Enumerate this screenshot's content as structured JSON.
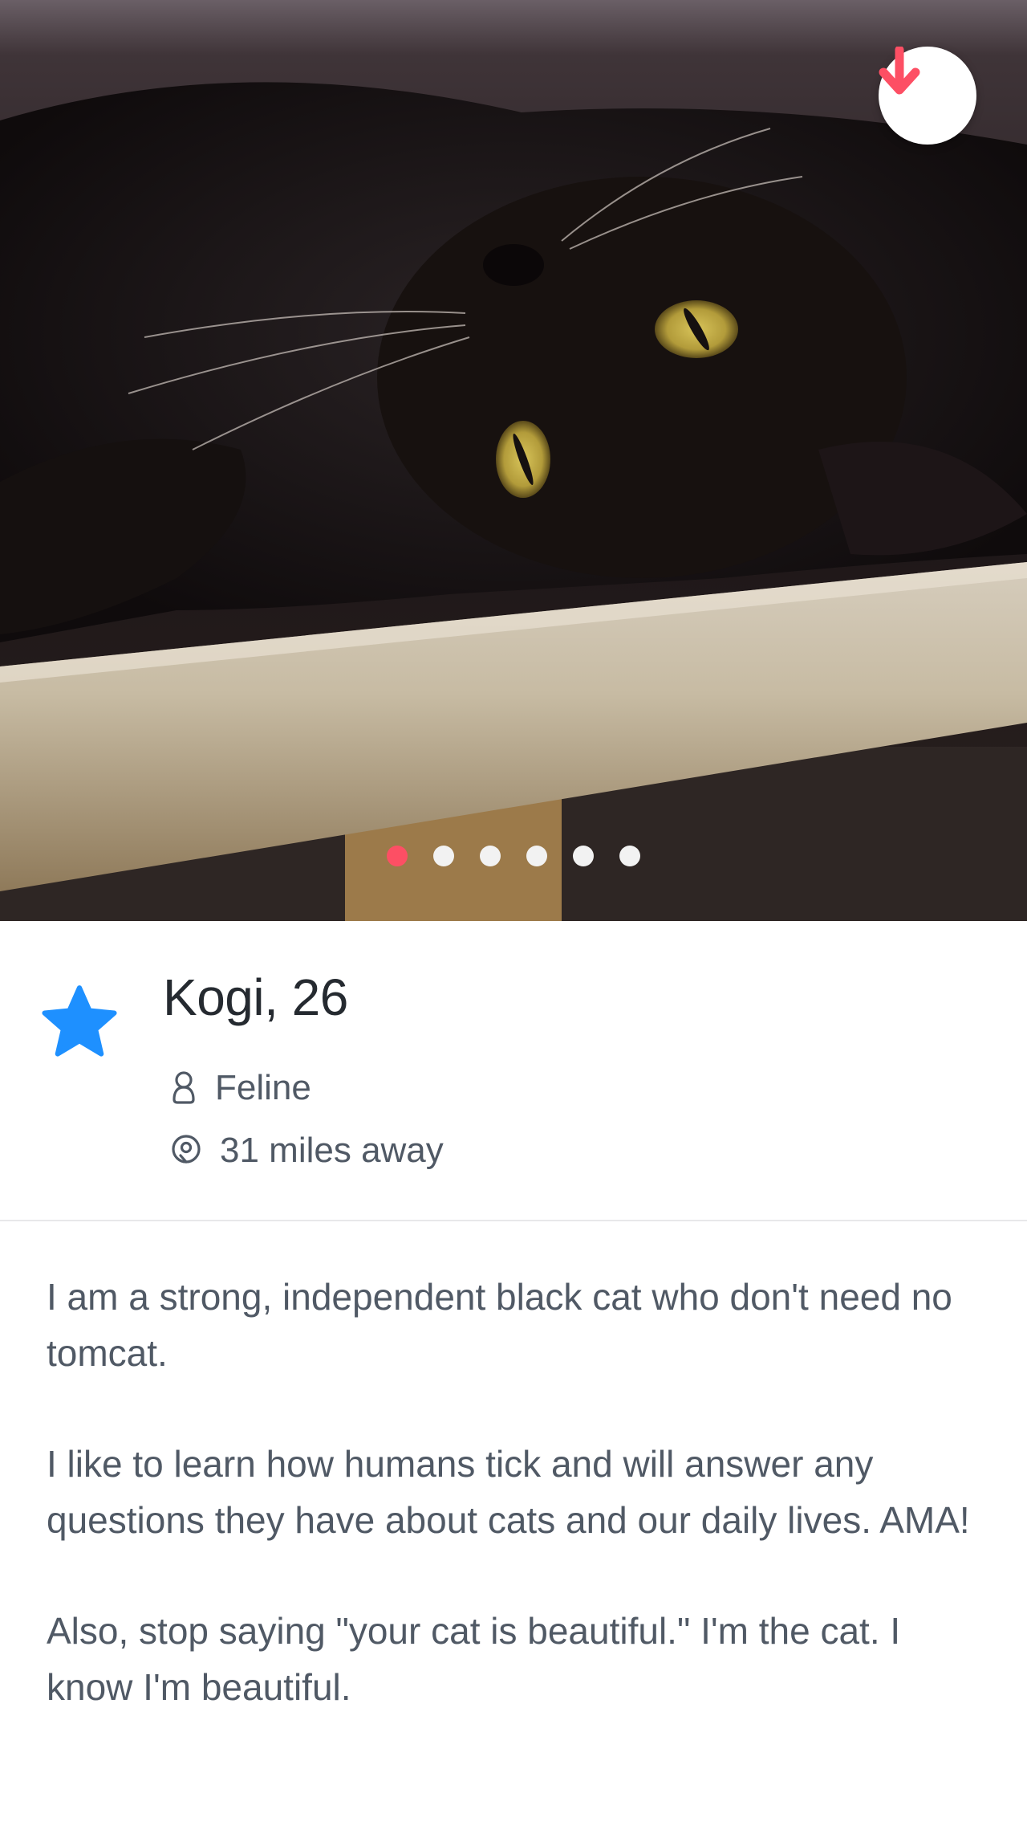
{
  "profile": {
    "name_age": "Kogi, 26",
    "gender": "Feline",
    "distance": "31 miles away",
    "bio": [
      "I am a strong, independent black cat who don't need no tomcat.",
      "I like to learn how humans tick and will answer any questions they have about cats and our daily lives. AMA!",
      "Also, stop saying \"your cat is beautiful.\" I'm the cat. I know I'm beautiful."
    ]
  },
  "photo": {
    "count": 6,
    "active_index": 0,
    "description": "black cat lying upside down on a wooden beam"
  },
  "icons": {
    "collapse": "arrow-down-icon",
    "super_like": "star-icon",
    "gender": "person-icon",
    "location": "location-pin-icon"
  },
  "colors": {
    "accent": "#fd4f64",
    "super_like": "#1e90ff",
    "text_primary": "#252a30",
    "text_secondary": "#505965"
  }
}
